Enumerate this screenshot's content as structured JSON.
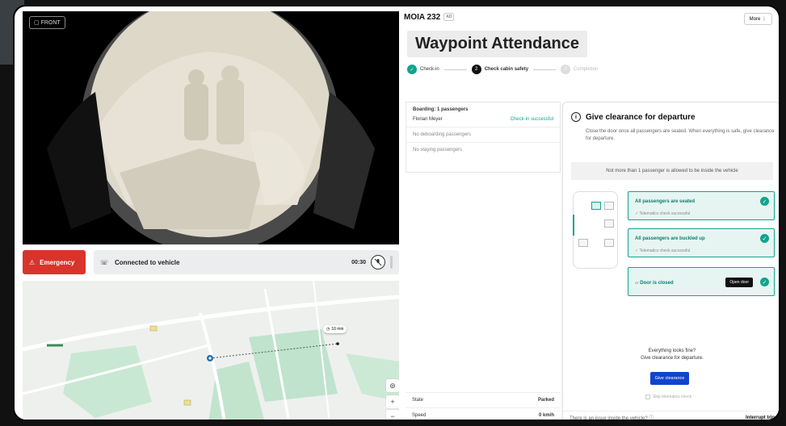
{
  "camera": {
    "label": "FRONT"
  },
  "emergency": {
    "label": "Emergency"
  },
  "call": {
    "status": "Connected to vehicle",
    "timer": "00:30"
  },
  "map": {
    "eta": "10 min"
  },
  "vehicle": {
    "name": "MOIA 232",
    "tag": "AD",
    "more_label": "More"
  },
  "page_title": "Waypoint Attendance",
  "steps": [
    {
      "num": "✓",
      "label": "Check-in"
    },
    {
      "num": "2",
      "label": "Check cabin safety"
    },
    {
      "num": "3",
      "label": "Completion"
    }
  ],
  "passengers": {
    "boarding": "Boarding: 1 passengers",
    "pax_name": "Florian Meyer",
    "pax_status": "Check-in successful",
    "deboarding": "No deboarding passengers",
    "staying": "No staying passengers"
  },
  "stats": [
    {
      "label": "State",
      "value": "Parked"
    },
    {
      "label": "Speed",
      "value": "0 km/h"
    }
  ],
  "clearance": {
    "title": "Give clearance for departure",
    "desc": "Close the door once all passengers are seated. When everything is safe, give clearance for departure.",
    "notice": "Not more than 1 passenger is allowed to be inside the vehicle",
    "checks": [
      {
        "title": "All passengers are seated",
        "sub": "Telematics check successful"
      },
      {
        "title": "All passengers are buckled up",
        "sub": "Telematics check successful"
      },
      {
        "title": "Door is closed",
        "sub": ""
      }
    ],
    "open_door": "Open door",
    "fine_1": "Everything looks fine?",
    "fine_2": "Give clearance for departure.",
    "go_label": "Give clearance",
    "skip_label": "Skip telematics check",
    "issue": "There is an issue inside the vehicle?",
    "interrupt": "Interrupt trip"
  },
  "colors": {
    "accent": "#12a38f",
    "danger": "#d9342b",
    "primary": "#1144cc"
  }
}
